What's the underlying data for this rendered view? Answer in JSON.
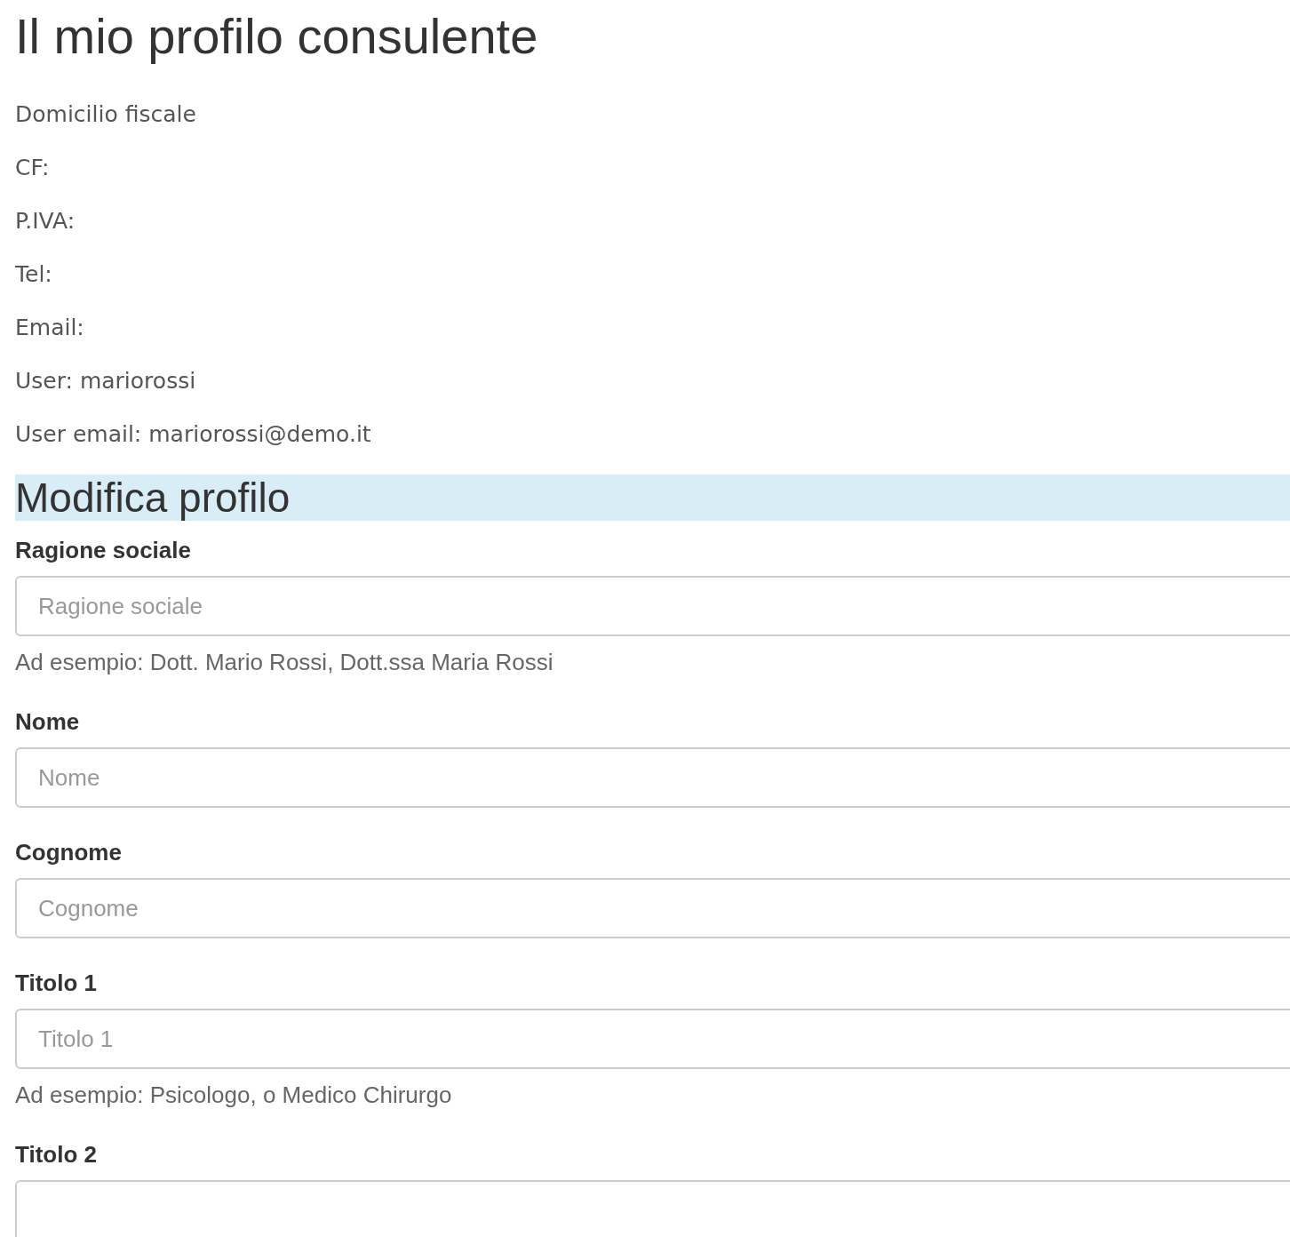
{
  "title": "Il mio profilo consulente",
  "info": [
    {
      "label": "Domicilio fiscale"
    },
    {
      "label": "CF:"
    },
    {
      "label": "P.IVA:"
    },
    {
      "label": "Tel:"
    },
    {
      "label": "Email:"
    },
    {
      "label": "User:",
      "value": "mariorossi"
    },
    {
      "label": "User email:",
      "value": "mariorossi@demo.it"
    }
  ],
  "section_title": "Modifica profilo",
  "fields": [
    {
      "label": "Ragione sociale",
      "placeholder": "Ragione sociale",
      "help": "Ad esempio: Dott. Mario Rossi, Dott.ssa Maria Rossi"
    },
    {
      "label": "Nome",
      "placeholder": "Nome"
    },
    {
      "label": "Cognome",
      "placeholder": "Cognome"
    },
    {
      "label": "Titolo 1",
      "placeholder": "Titolo 1",
      "help": "Ad esempio: Psicologo, o Medico Chirurgo"
    },
    {
      "label": "Titolo 2"
    }
  ]
}
